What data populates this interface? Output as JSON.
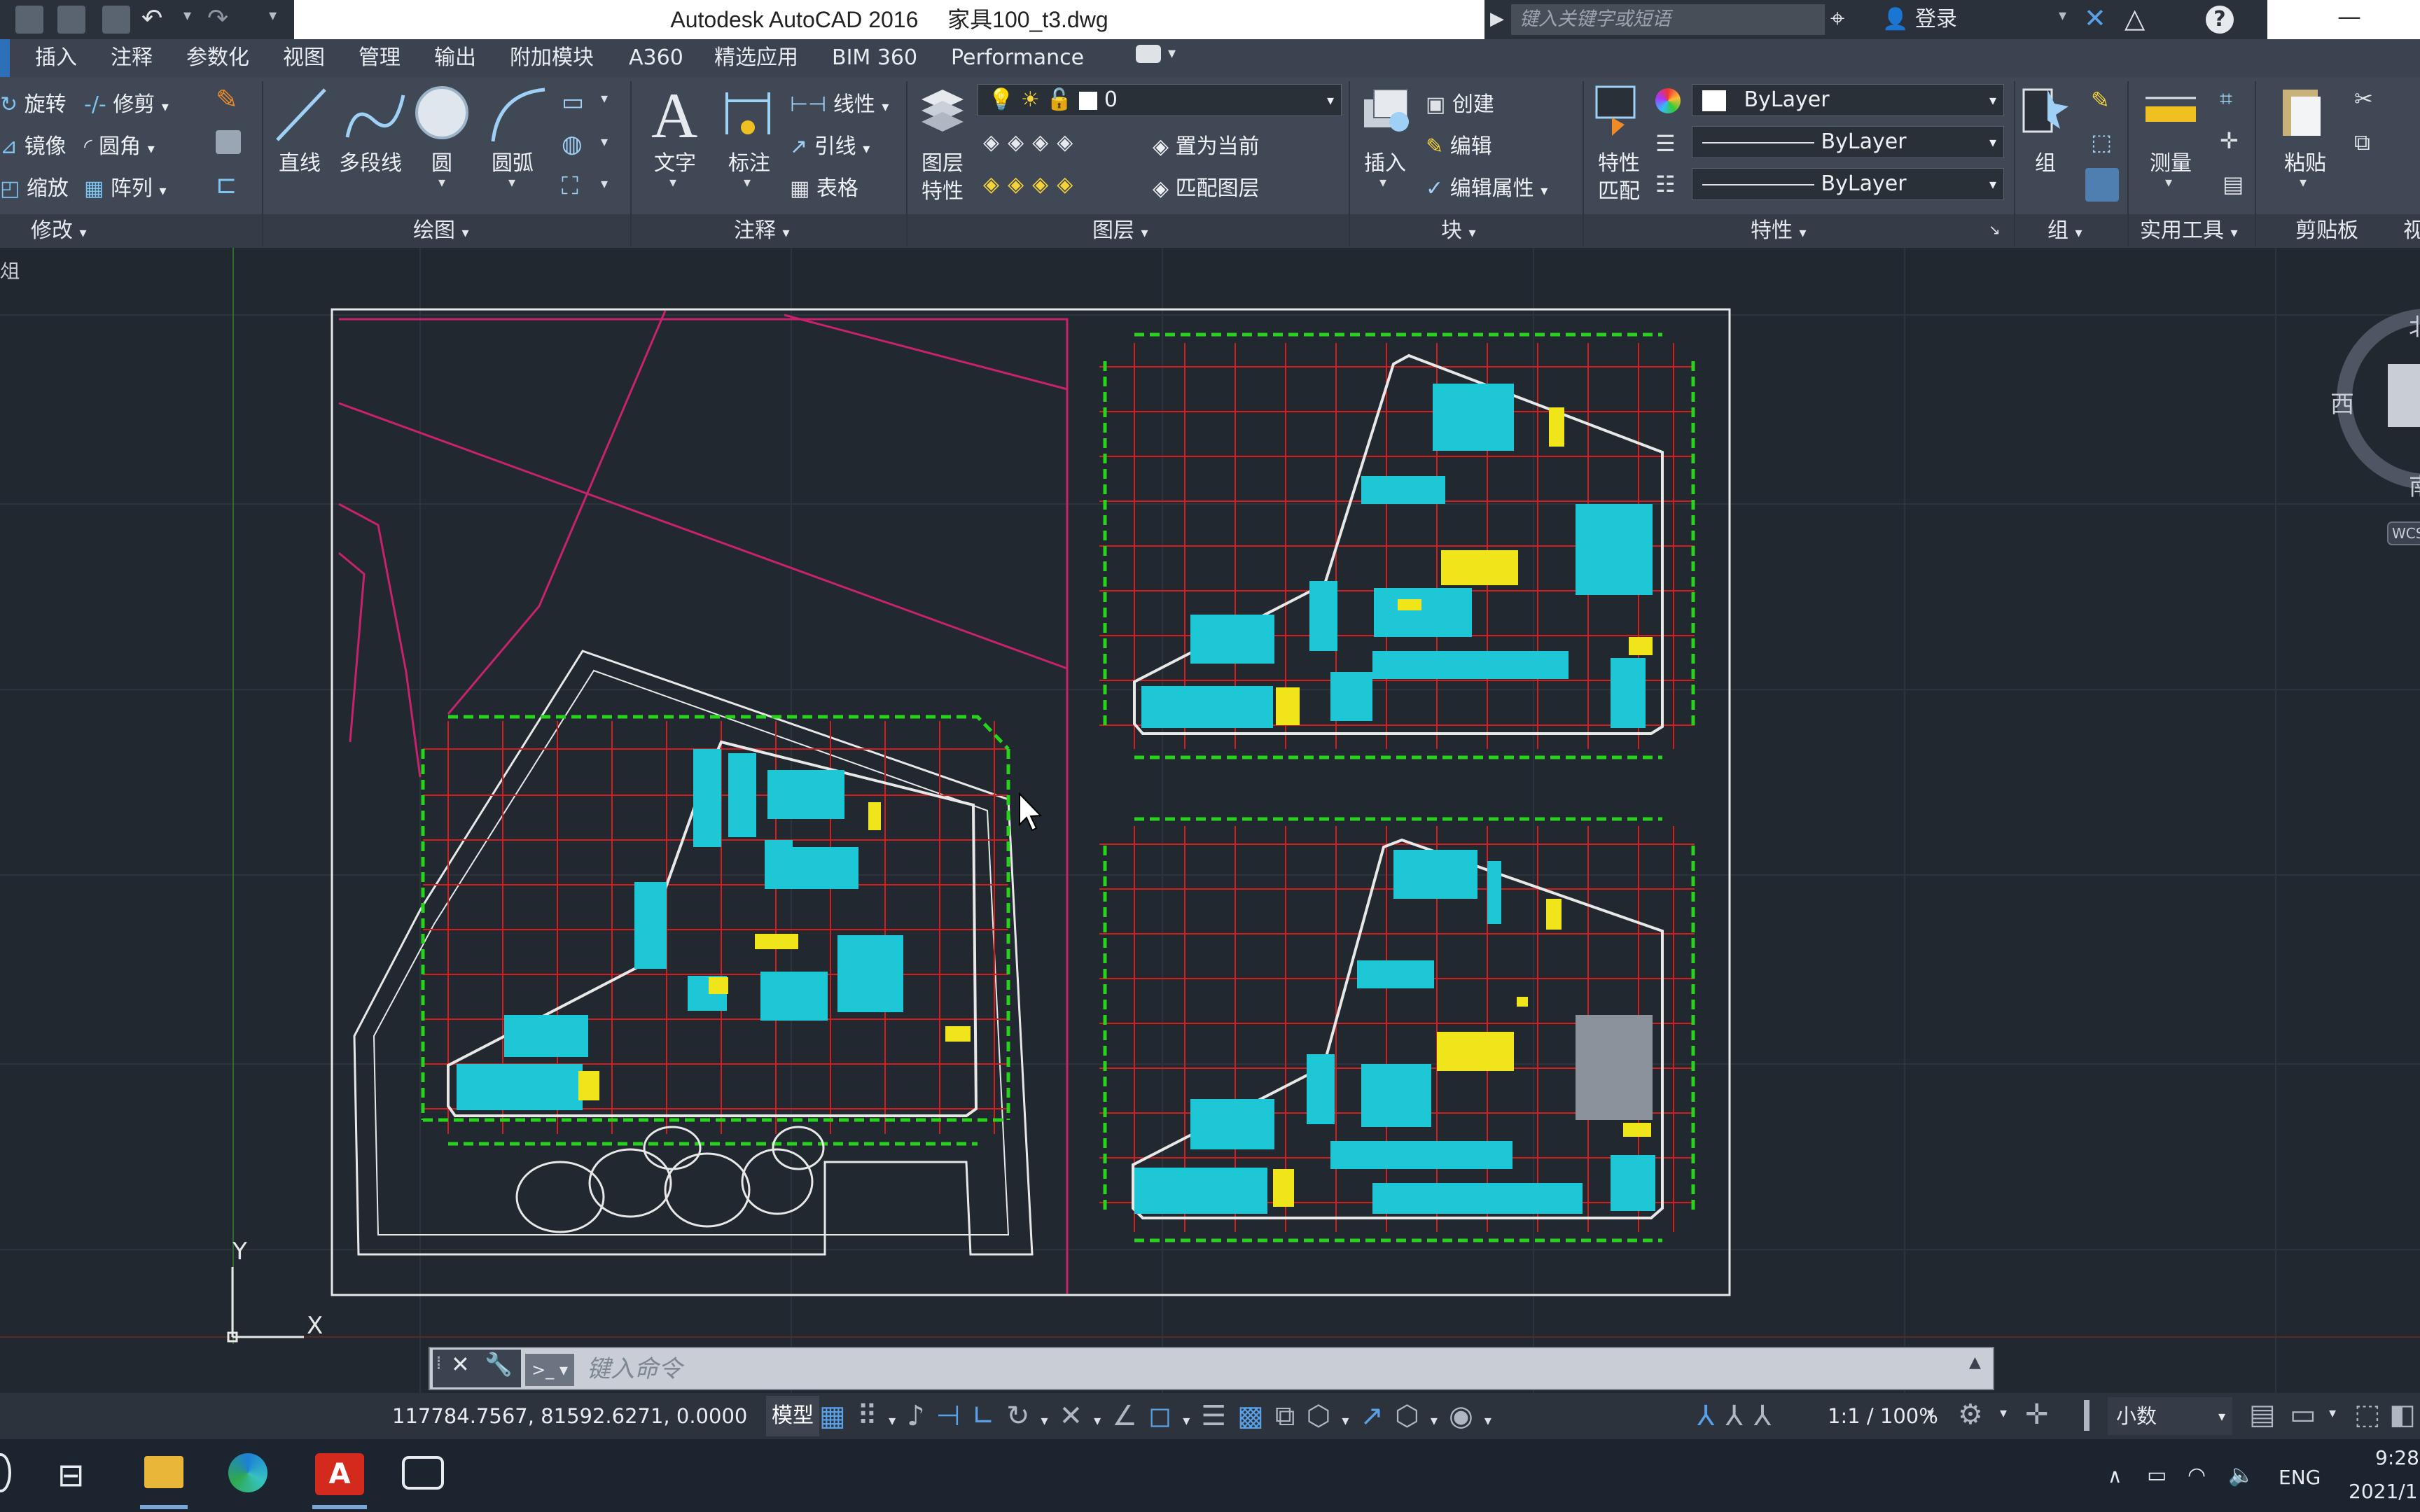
{
  "window": {
    "app_title": "Autodesk AutoCAD 2016",
    "file_name": "家具100_t3.dwg",
    "search_placeholder": "键入关键字或短语",
    "login_label": "登录"
  },
  "ribbon_tabs": [
    "插入",
    "注释",
    "参数化",
    "视图",
    "管理",
    "输出",
    "附加模块",
    "A360",
    "精选应用",
    "BIM 360",
    "Performance"
  ],
  "ribbon": {
    "modify": {
      "title": "修改",
      "items": [
        "旋转",
        "修剪",
        "镜像",
        "圆角",
        "缩放",
        "阵列"
      ]
    },
    "draw": {
      "title": "绘图",
      "items": [
        "直线",
        "多段线",
        "圆",
        "圆弧"
      ]
    },
    "annotation": {
      "title": "注释",
      "items": [
        "文字",
        "标注",
        "线性",
        "引线",
        "表格"
      ]
    },
    "layers": {
      "title": "图层",
      "layer_props_l1": "图层",
      "layer_props_l2": "特性",
      "current_layer": "0",
      "set_current": "置为当前",
      "match_layer": "匹配图层"
    },
    "block": {
      "title": "块",
      "insert": "插入",
      "create": "创建",
      "edit": "编辑",
      "edit_attr": "编辑属性"
    },
    "properties": {
      "title": "特性",
      "match_l1": "特性",
      "match_l2": "匹配",
      "color": "ByLayer",
      "linetype": "ByLayer",
      "lineweight": "ByLayer"
    },
    "groups": {
      "title": "组",
      "group": "组"
    },
    "utilities": {
      "title": "实用工具",
      "measure": "测量"
    },
    "clipboard": {
      "title": "剪贴板",
      "paste": "粘贴"
    },
    "view_cut": "视"
  },
  "viewport": {
    "label": "西",
    "compass_north": "北",
    "compass_south": "南",
    "wcs": "WCS",
    "ucs_x": "X",
    "ucs_y": "Y",
    "side_label": "俎"
  },
  "command_line": {
    "placeholder": "键入命令"
  },
  "status_bar": {
    "coordinates": "117784.7567, 81592.6271, 0.0000",
    "model_label": "模型",
    "annotation_scale": "1:1 / 100%",
    "units": "小数"
  },
  "taskbar": {
    "language": "ENG",
    "time": "9:28",
    "date": "2021/1"
  },
  "colors": {
    "background": "#212830",
    "ribbon": "#404855",
    "grid_red": "#d41e1e",
    "dim_green": "#27d41b",
    "furniture_cyan": "#1ec7d6",
    "highlight_yellow": "#f0e41a",
    "site_magenta": "#c8226e",
    "outline_white": "#e8e8e8",
    "autocad_red": "#d42a1e"
  }
}
